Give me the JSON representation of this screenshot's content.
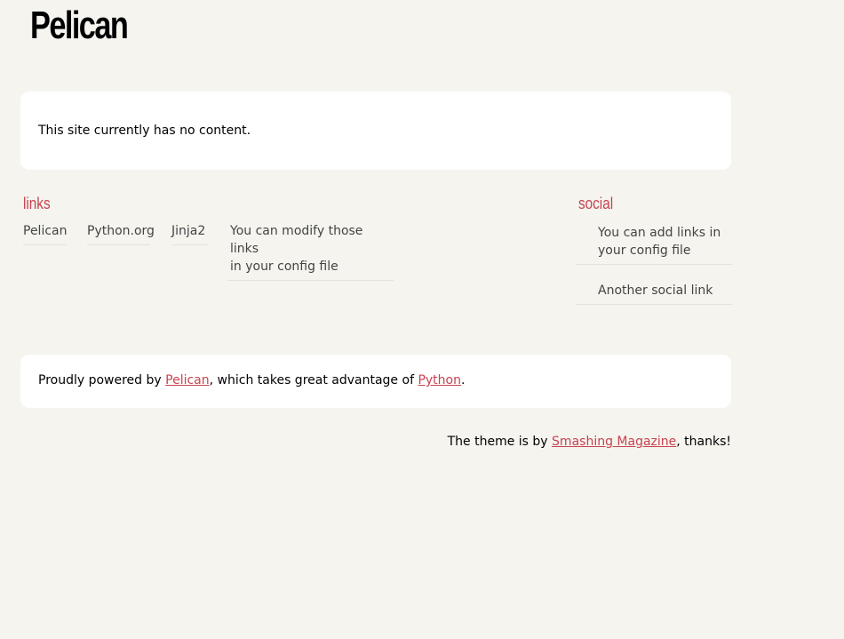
{
  "header": {
    "site_title": "Pelican"
  },
  "content": {
    "message": "This site currently has no content."
  },
  "links": {
    "heading": "links",
    "items": [
      {
        "label": "Pelican"
      },
      {
        "label": "Python.org"
      },
      {
        "label": "Jinja2"
      },
      {
        "label_line1": "You can modify those links",
        "label_line2": "in your config file"
      }
    ]
  },
  "social": {
    "heading": "social",
    "items": [
      {
        "label_line1": "You can add links in",
        "label_line2": "your config file"
      },
      {
        "label": "Another social link"
      }
    ]
  },
  "footer": {
    "prefix": "Proudly powered by ",
    "pelican_link": "Pelican",
    "middle": ", which takes great advantage of ",
    "python_link": "Python",
    "suffix": "."
  },
  "credit": {
    "prefix": "The theme is by ",
    "link": "Smashing Magazine",
    "suffix": ", thanks!"
  },
  "colors": {
    "background": "#f5f4ef",
    "accent": "#c74350",
    "box": "#ffffff"
  }
}
